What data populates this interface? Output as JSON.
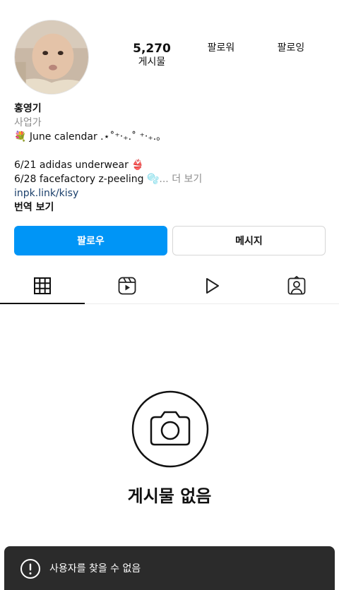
{
  "profile": {
    "username": "홍영기",
    "category": "사업가",
    "avatar_icon": "baby-photo-avatar"
  },
  "stats": {
    "posts_value": "5,270",
    "posts_label": "게시물",
    "followers_label": "팔로워",
    "following_label": "팔로잉"
  },
  "bio": {
    "line1": "💐 June calendar .⋆˚⁺‧₊.˚ ⁺‧₊.。",
    "line2": "6/21 adidas underwear 👙",
    "line3_text": "6/28 facefactory z-peeling 🫧",
    "line3_more": "... 더 보기",
    "link": "inpk.link/kisy",
    "translate": "번역 보기"
  },
  "actions": {
    "follow_label": "팔로우",
    "message_label": "메시지",
    "follow_color": "#0095f6"
  },
  "tabs": [
    {
      "icon": "grid-icon",
      "active": true
    },
    {
      "icon": "reels-icon",
      "active": false
    },
    {
      "icon": "play-icon",
      "active": false
    },
    {
      "icon": "tagged-icon",
      "active": false
    }
  ],
  "empty_state": {
    "icon": "camera-icon",
    "title": "게시물 없음"
  },
  "toast": {
    "icon": "alert-icon",
    "message": "사용자를 찾을 수 없음"
  }
}
